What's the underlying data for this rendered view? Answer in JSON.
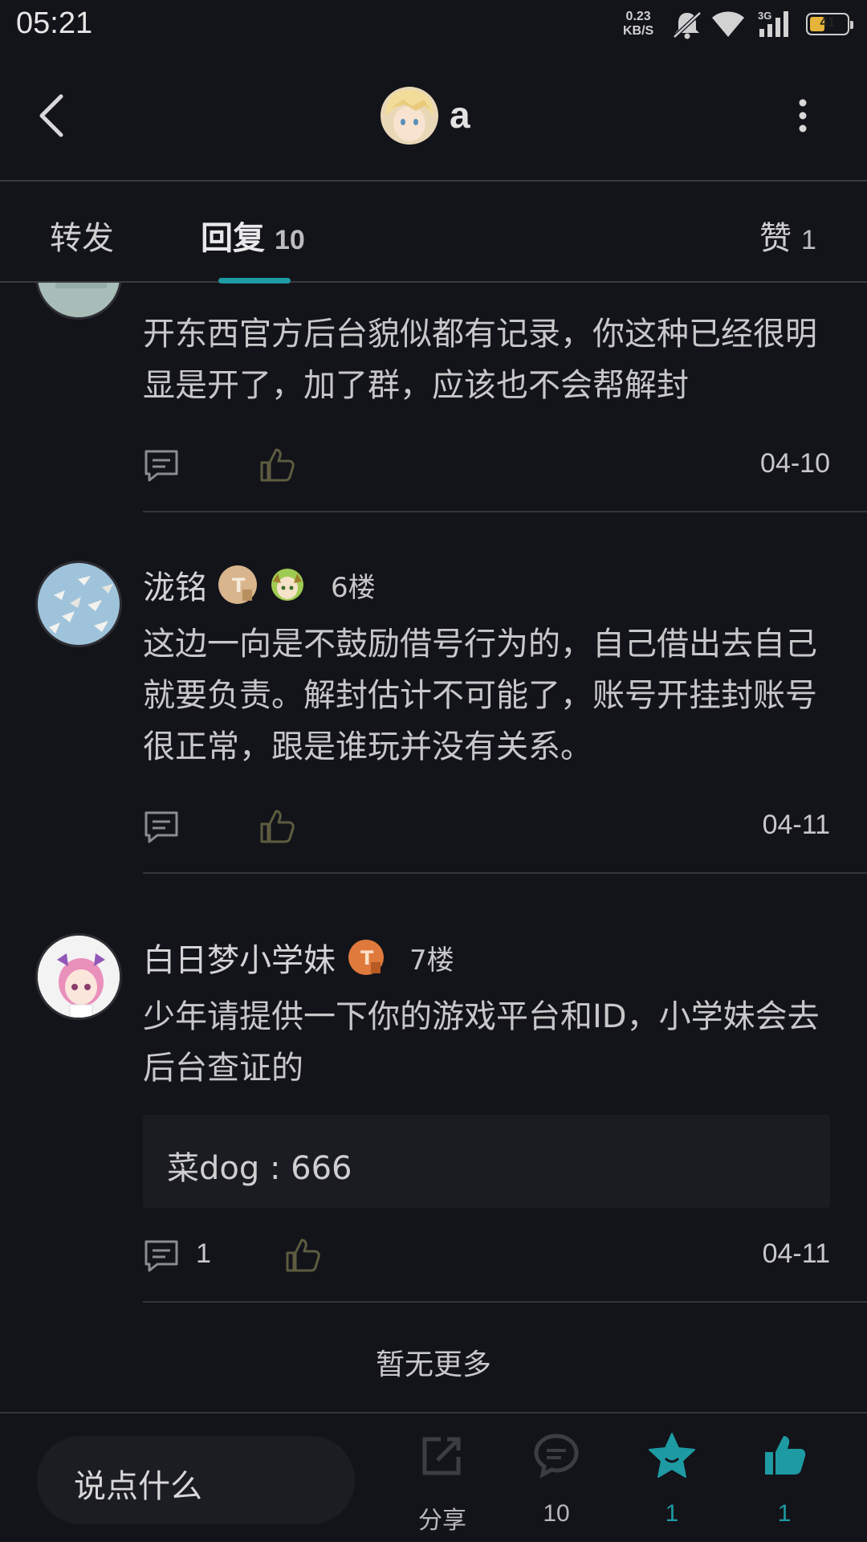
{
  "status_bar": {
    "time": "05:21",
    "speed_value": "0.23",
    "speed_unit": "KB/S",
    "network": "3G",
    "battery": "41",
    "battery_level_percent": 41,
    "icons": [
      "mute-bell-icon",
      "wifi-icon",
      "signal-icon",
      "battery-icon"
    ]
  },
  "header": {
    "title": "a",
    "icons": [
      "back-arrow-icon",
      "avatar",
      "more-vertical-icon"
    ]
  },
  "tabs": [
    {
      "label": "转发",
      "count": ""
    },
    {
      "label": "回复",
      "count": "10",
      "active": true
    },
    {
      "label": "赞",
      "count": "1"
    }
  ],
  "posts": [
    {
      "user": "",
      "floor": "",
      "text": "开东西官方后台貌似都有记录，你这种已经很明显是开了，加了群，应该也不会帮解封",
      "comment_count": "",
      "date": "04-10"
    },
    {
      "user": "泷铭",
      "floor": "6楼",
      "text": "这边一向是不鼓励借号行为的，自己借出去自己就要负责。解封估计不可能了，账号开挂封账号很正常，跟是谁玩并没有关系。",
      "comment_count": "",
      "date": "04-11"
    },
    {
      "user": "白日梦小学妹",
      "floor": "7楼",
      "text": "少年请提供一下你的游戏平台和ID，小学妹会去后台查证的",
      "quote": "菜dog : 666",
      "comment_count": "1",
      "date": "04-11"
    }
  ],
  "no_more": "暂无更多",
  "bottom_bar": {
    "input_placeholder": "说点什么",
    "share_label": "分享",
    "comment_count": "10",
    "favorite_count": "1",
    "like_count": "1",
    "accent_color": "#1e9aa3"
  }
}
